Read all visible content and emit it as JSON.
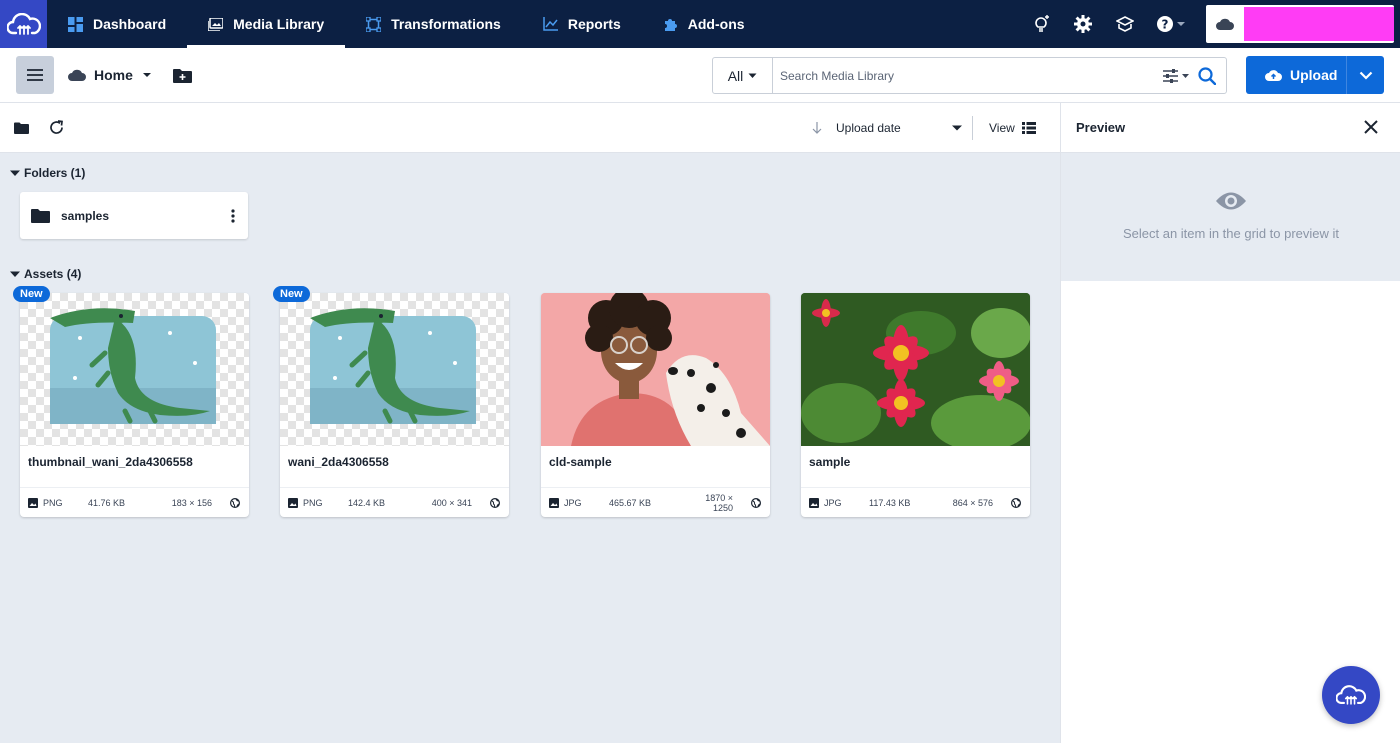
{
  "nav": {
    "items": [
      {
        "label": "Dashboard",
        "icon": "dashboard-icon"
      },
      {
        "label": "Media Library",
        "icon": "media-library-icon",
        "active": true
      },
      {
        "label": "Transformations",
        "icon": "transformations-icon"
      },
      {
        "label": "Reports",
        "icon": "reports-icon"
      },
      {
        "label": "Add-ons",
        "icon": "puzzle-icon"
      }
    ],
    "right_icons": [
      "lightbulb-icon",
      "gear-icon",
      "graduation-cap-icon",
      "help-icon"
    ],
    "account_name": ""
  },
  "toolbar": {
    "home_label": "Home",
    "search": {
      "scope": "All",
      "placeholder": "Search Media Library"
    },
    "upload_label": "Upload"
  },
  "subbar": {
    "sort_label": "Upload date",
    "view_label": "View"
  },
  "folders": {
    "header": "Folders (1)",
    "items": [
      {
        "name": "samples"
      }
    ]
  },
  "assets": {
    "header": "Assets (4)",
    "items": [
      {
        "name": "thumbnail_wani_2da4306558",
        "format": "PNG",
        "size": "41.76 KB",
        "dimensions": "183 × 156",
        "badge": "New"
      },
      {
        "name": "wani_2da4306558",
        "format": "PNG",
        "size": "142.4 KB",
        "dimensions": "400 × 341",
        "badge": "New"
      },
      {
        "name": "cld-sample",
        "format": "JPG",
        "size": "465.67 KB",
        "dimensions": "1870 × 1250"
      },
      {
        "name": "sample",
        "format": "JPG",
        "size": "117.43 KB",
        "dimensions": "864 × 576"
      }
    ]
  },
  "preview": {
    "title": "Preview",
    "empty_message": "Select an item in the grid to preview it"
  },
  "colors": {
    "nav_bg": "#0c2043",
    "logo_bg": "#3448c5",
    "primary": "#0d69d9",
    "content_bg": "#e6ebf2",
    "account_highlight": "#ff3cf5"
  }
}
